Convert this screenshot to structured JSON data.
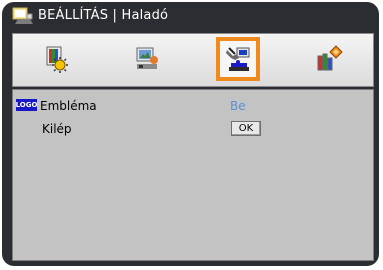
{
  "window": {
    "title": "BEÁLLÍTÁS | Haladó"
  },
  "tabs": [
    {
      "name": "image-settings",
      "selected": false
    },
    {
      "name": "display-settings",
      "selected": false
    },
    {
      "name": "settings",
      "selected": true
    },
    {
      "name": "options",
      "selected": false
    }
  ],
  "menu": {
    "emblem": {
      "badge": "LOGO",
      "label": "Embléma",
      "value": "Be"
    },
    "exit": {
      "label": "Kilép",
      "button": "OK"
    }
  },
  "colors": {
    "accent": "#f08a1c",
    "value_text": "#5b8fd6",
    "frame": "#2a2d31",
    "content_bg": "#c3c3c3"
  }
}
